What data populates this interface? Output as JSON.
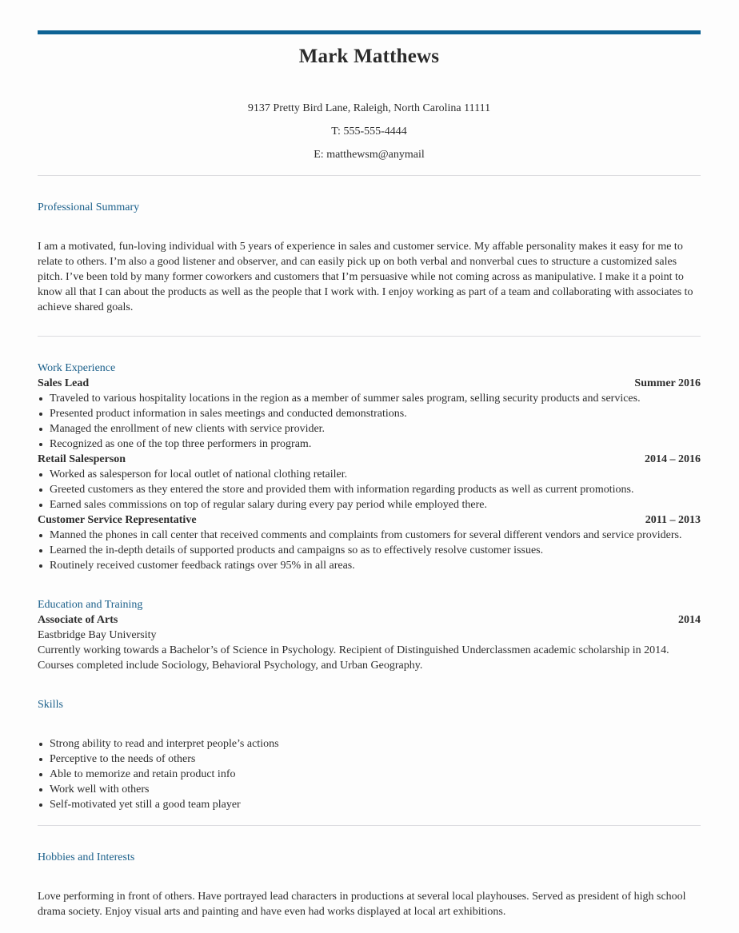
{
  "header": {
    "name": "Mark Matthews",
    "address": "9137 Pretty Bird Lane, Raleigh, North Carolina 11111",
    "phone": "T: 555-555-4444",
    "email": "E: matthewsm@anymail"
  },
  "summary": {
    "title": "Professional Summary",
    "text": "I am a motivated, fun-loving individual with 5 years of experience in sales and customer service. My affable personality makes it easy for me to relate to others. I’m also a good listener and observer, and can easily pick up on both verbal and nonverbal cues to structure a customized sales pitch. I’ve been told by many former coworkers and customers that I’m persuasive while not coming across as manipulative. I make it a point to know all that I can about the products as well as the people that I work with. I enjoy working as part of a team and collaborating with associates to achieve shared goals."
  },
  "experience": {
    "title": "Work Experience",
    "jobs": [
      {
        "role": "Sales Lead",
        "dates": "Summer 2016",
        "bullets": [
          "Traveled to various hospitality locations in the region as a member of summer sales program, selling security products and services.",
          "Presented product information in sales meetings and conducted demonstrations.",
          "Managed the enrollment of new clients with service provider.",
          "Recognized as one of the top three performers in program."
        ]
      },
      {
        "role": "Retail Salesperson",
        "dates": "2014 – 2016",
        "bullets": [
          "Worked as salesperson for local outlet of national clothing retailer.",
          "Greeted customers as they entered the store and provided them with information regarding products as well as current promotions.",
          "Earned sales commissions on top of regular salary during every pay period while employed there."
        ]
      },
      {
        "role": "Customer Service Representative",
        "dates": "2011 – 2013",
        "bullets": [
          "Manned the phones in call center that received comments and complaints from customers for several different vendors and service providers.",
          "Learned the in-depth details of supported products and campaigns so as to effectively resolve customer issues.",
          "Routinely received customer feedback ratings over 95% in all areas."
        ]
      }
    ]
  },
  "education": {
    "title": "Education and Training",
    "degree": "Associate of Arts",
    "year": "2014",
    "school": "Eastbridge Bay University",
    "details": "Currently working towards a Bachelor’s of Science in Psychology. Recipient of Distinguished Underclassmen academic scholarship in 2014. Courses completed include Sociology, Behavioral Psychology, and Urban Geography."
  },
  "skills": {
    "title": "Skills",
    "items": [
      "Strong ability to read and interpret people’s actions",
      "Perceptive to the needs of others",
      "Able to memorize and retain product info",
      "Work well with others",
      "Self-motivated yet still a good team player"
    ]
  },
  "hobbies": {
    "title": "Hobbies and Interests",
    "text": "Love performing in front of others. Have portrayed lead characters in productions at several local playhouses. Served as president of high school drama society. Enjoy visual arts and painting and have even had works displayed at local art exhibitions."
  }
}
